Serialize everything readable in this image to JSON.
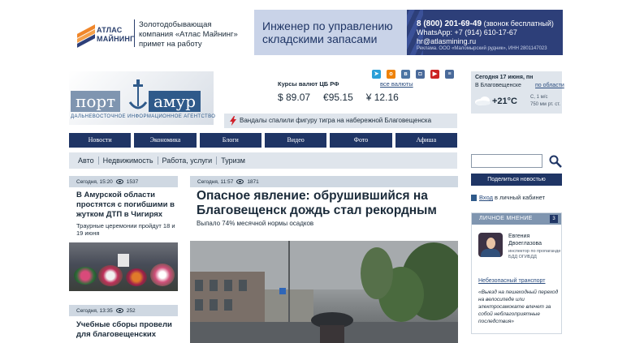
{
  "banner": {
    "brand_line1": "АТЛАС",
    "brand_line2": "МАЙНИНГ",
    "job_line1": "Золотодобывающая",
    "job_line2": "компания «Атлас Майнинг»",
    "job_line3": "примет на работу",
    "position_line1": "Инженер по управлению",
    "position_line2": "складскими запасами",
    "phone": "8 (800) 201-69-49",
    "phone_note": "(звонок бесплатный)",
    "whatsapp": "WhatsApp: +7 (914) 610-17-67",
    "email": "hr@atlasmining.ru",
    "ad_note": "Реклама. ООО «Маломырский рудник», ИНН 2801147023",
    "colors": {
      "brand_dark": "#2d3f79",
      "brand_light": "#c9d3e8",
      "orange": "#f0862a"
    }
  },
  "site": {
    "logo_left": "порт",
    "logo_right": "амур",
    "tagline": "ДАЛЬНЕВОСТОЧНОЕ ИНФОРМАЦИОННОЕ АГЕНТСТВО"
  },
  "currency": {
    "title": "Курсы валют ЦБ РФ",
    "all_link": "все валюты",
    "rates": [
      "$ 89.07",
      "€95.15",
      "¥ 12.16"
    ]
  },
  "socials": [
    {
      "icon": "telegram-icon",
      "color": "#2a9fd8",
      "glyph": "➤"
    },
    {
      "icon": "ok-icon",
      "color": "#ee8208",
      "glyph": "о"
    },
    {
      "icon": "vk-icon",
      "color": "#4c75a3",
      "glyph": "в"
    },
    {
      "icon": "camera-icon",
      "color": "#4a6a9a",
      "glyph": "◘"
    },
    {
      "icon": "youtube-icon",
      "color": "#cc2222",
      "glyph": "▶"
    },
    {
      "icon": "rss-icon",
      "color": "#4a6a9a",
      "glyph": "≡"
    }
  ],
  "breaking": {
    "text": "Вандалы спалили фигуру тигра на набережной Благовещенска"
  },
  "weather": {
    "date": "Сегодня 17 июня, пн",
    "city": "В Благовещенске",
    "region_link": "по области",
    "temp": "+21°C",
    "wind": "С, 1 м/с",
    "pressure": "750 мм рт. ст."
  },
  "nav": [
    "Новости",
    "Экономика",
    "Блоги",
    "Видео",
    "Фото",
    "Афиша"
  ],
  "subnav": [
    "Авто",
    "Недвижимость",
    "Работа, услуги",
    "Туризм"
  ],
  "sidebar": {
    "share_label": "Поделиться новостью",
    "cabinet_link": "Вход",
    "cabinet_text": " в личный кабинет",
    "opinion": {
      "title": "ЛИЧНОЕ МНЕНИЕ",
      "count": "3",
      "name": "Евгения Двоеглазова",
      "role": "инспектор по пропаганде БДД ОГИБДД",
      "topic": "Небезопасный транспорт",
      "quote": "«Выезд на пешеходный переход на велосипеде или электросамокате влечет за собой неблагоприятные последствия»"
    }
  },
  "news_left": [
    {
      "time": "Сегодня, 15:20",
      "views": "1537",
      "title": "В Амурской области простятся с погибшими в жутком ДТП в Чигирях",
      "sub": "Траурные церемонии пройдут 18 и 19 июня"
    },
    {
      "time": "Сегодня, 13:35",
      "views": "252",
      "title": "Учебные сборы провели для благовещенских"
    }
  ],
  "main_news": {
    "time": "Сегодня, 11:57",
    "views": "1871",
    "title": "Опасное явление: обрушившийся на Благовещенск дождь стал рекордным",
    "sub": "Выпало 74% месячной нормы осадков"
  }
}
